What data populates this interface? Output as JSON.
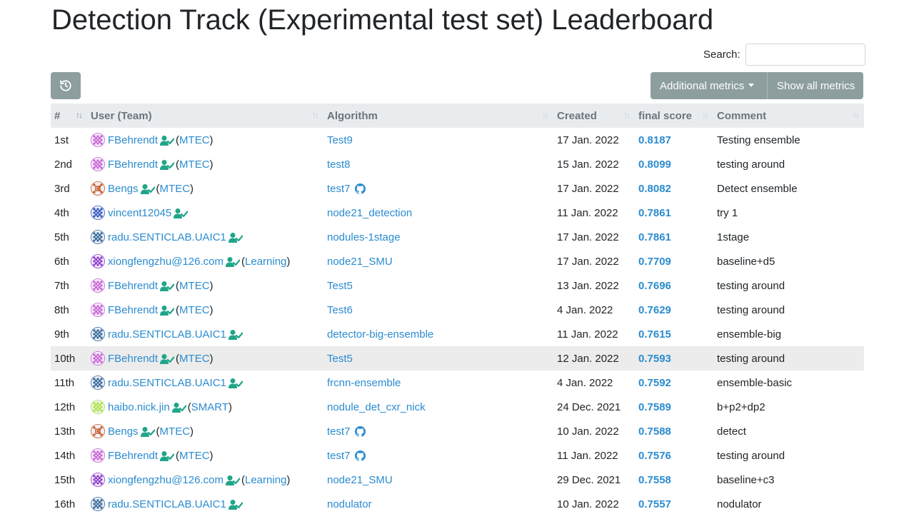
{
  "page": {
    "title": "Detection Track (Experimental test set) Leaderboard"
  },
  "search": {
    "label": "Search:",
    "value": "",
    "placeholder": ""
  },
  "toolbar": {
    "history_icon": "history-icon",
    "additional_metrics_label": "Additional metrics",
    "show_all_metrics_label": "Show all metrics"
  },
  "table": {
    "headers": [
      "#",
      "User (Team)",
      "Algorithm",
      "Created",
      "final score",
      "Comment"
    ],
    "rows": [
      {
        "rank": "1st",
        "user": "FBehrendt",
        "team": "MTEC",
        "avatar": "pink",
        "verified": true,
        "algorithm": "Test9",
        "github": false,
        "created": "17 Jan. 2022",
        "score": "0.8187",
        "comment": "Testing ensemble",
        "highlight": false
      },
      {
        "rank": "2nd",
        "user": "FBehrendt",
        "team": "MTEC",
        "avatar": "pink",
        "verified": true,
        "algorithm": "test8",
        "github": false,
        "created": "15 Jan. 2022",
        "score": "0.8099",
        "comment": "testing around",
        "highlight": false
      },
      {
        "rank": "3rd",
        "user": "Bengs",
        "team": "MTEC",
        "avatar": "orange",
        "verified": true,
        "algorithm": "test7",
        "github": true,
        "created": "17 Jan. 2022",
        "score": "0.8082",
        "comment": "Detect ensemble",
        "highlight": false
      },
      {
        "rank": "4th",
        "user": "vincent12045",
        "team": "",
        "avatar": "blue",
        "verified": true,
        "algorithm": "node21_detection",
        "github": false,
        "created": "11 Jan. 2022",
        "score": "0.7861",
        "comment": "try 1",
        "highlight": false
      },
      {
        "rank": "5th",
        "user": "radu.SENTICLAB.UAIC1",
        "team": "",
        "avatar": "steel",
        "verified": true,
        "algorithm": "nodules-1stage",
        "github": false,
        "created": "17 Jan. 2022",
        "score": "0.7861",
        "comment": "1stage",
        "highlight": false
      },
      {
        "rank": "6th",
        "user": "xiongfengzhu@126.com",
        "team": "Learning",
        "avatar": "purple",
        "verified": true,
        "algorithm": "node21_SMU",
        "github": false,
        "created": "17 Jan. 2022",
        "score": "0.7709",
        "comment": "baseline+d5",
        "highlight": false
      },
      {
        "rank": "7th",
        "user": "FBehrendt",
        "team": "MTEC",
        "avatar": "pink",
        "verified": true,
        "algorithm": "Test5",
        "github": false,
        "created": "13 Jan. 2022",
        "score": "0.7696",
        "comment": "testing around",
        "highlight": false
      },
      {
        "rank": "8th",
        "user": "FBehrendt",
        "team": "MTEC",
        "avatar": "pink",
        "verified": true,
        "algorithm": "Test6",
        "github": false,
        "created": "4 Jan. 2022",
        "score": "0.7629",
        "comment": "testing around",
        "highlight": false
      },
      {
        "rank": "9th",
        "user": "radu.SENTICLAB.UAIC1",
        "team": "",
        "avatar": "steel",
        "verified": true,
        "algorithm": "detector-big-ensemble",
        "github": false,
        "created": "11 Jan. 2022",
        "score": "0.7615",
        "comment": "ensemble-big",
        "highlight": false
      },
      {
        "rank": "10th",
        "user": "FBehrendt",
        "team": "MTEC",
        "avatar": "pink",
        "verified": true,
        "algorithm": "Test5",
        "github": false,
        "created": "12 Jan. 2022",
        "score": "0.7593",
        "comment": "testing around",
        "highlight": true
      },
      {
        "rank": "11th",
        "user": "radu.SENTICLAB.UAIC1",
        "team": "",
        "avatar": "steel",
        "verified": true,
        "algorithm": "frcnn-ensemble",
        "github": false,
        "created": "4 Jan. 2022",
        "score": "0.7592",
        "comment": "ensemble-basic",
        "highlight": false
      },
      {
        "rank": "12th",
        "user": "haibo.nick.jin",
        "team": "SMART",
        "avatar": "lime",
        "verified": true,
        "algorithm": "nodule_det_cxr_nick",
        "github": false,
        "created": "24 Dec. 2021",
        "score": "0.7589",
        "comment": "b+p2+dp2",
        "highlight": false
      },
      {
        "rank": "13th",
        "user": "Bengs",
        "team": "MTEC",
        "avatar": "orange",
        "verified": true,
        "algorithm": "test7",
        "github": true,
        "created": "10 Jan. 2022",
        "score": "0.7588",
        "comment": "detect",
        "highlight": false
      },
      {
        "rank": "14th",
        "user": "FBehrendt",
        "team": "MTEC",
        "avatar": "pink",
        "verified": true,
        "algorithm": "test7",
        "github": true,
        "created": "11 Jan. 2022",
        "score": "0.7576",
        "comment": "testing around",
        "highlight": false
      },
      {
        "rank": "15th",
        "user": "xiongfengzhu@126.com",
        "team": "Learning",
        "avatar": "purple",
        "verified": true,
        "algorithm": "node21_SMU",
        "github": false,
        "created": "29 Dec. 2021",
        "score": "0.7558",
        "comment": "baseline+c3",
        "highlight": false
      },
      {
        "rank": "16th",
        "user": "radu.SENTICLAB.UAIC1",
        "team": "",
        "avatar": "steel",
        "verified": true,
        "algorithm": "nodulator",
        "github": false,
        "created": "10 Jan. 2022",
        "score": "0.7557",
        "comment": "nodulator",
        "highlight": false
      }
    ]
  },
  "colors": {
    "link": "#2b8ccf",
    "button_bg": "#8d9e9e",
    "header_bg": "#e9ecef",
    "verified": "#20a589",
    "avatar_pink": "#c860d8",
    "avatar_orange": "#c2561e",
    "avatar_blue": "#2a56c0",
    "avatar_steel": "#2f6a9a",
    "avatar_purple": "#8a38d0",
    "avatar_lime": "#a6e63a"
  }
}
